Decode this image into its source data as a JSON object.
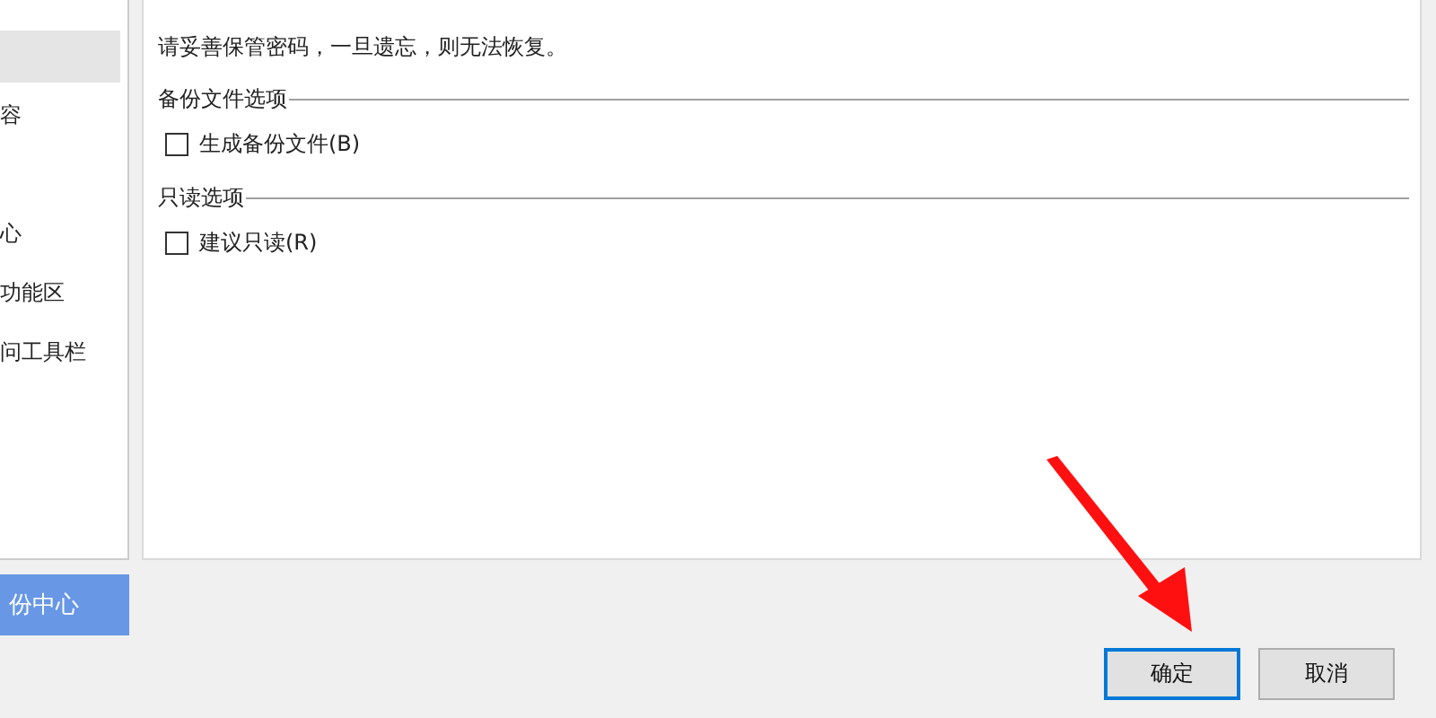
{
  "sidebar": {
    "items": [
      {
        "selected": true
      },
      {
        "label": "容",
        "selected": false
      },
      {
        "label": "心",
        "selected": false
      },
      {
        "label": "功能区",
        "selected": false
      },
      {
        "label": "问工具栏",
        "selected": false
      }
    ],
    "backup_button": "份中心"
  },
  "panel": {
    "note": "请妥善保管密码，一旦遗忘，则无法恢复。",
    "groups": [
      {
        "title": "备份文件选项",
        "options": [
          {
            "label": "生成备份文件(B)",
            "checked": false
          }
        ]
      },
      {
        "title": "只读选项",
        "options": [
          {
            "label": "建议只读(R)",
            "checked": false
          }
        ]
      }
    ]
  },
  "buttons": [
    {
      "label": "确定",
      "default": true
    },
    {
      "label": "取消",
      "default": false
    }
  ]
}
